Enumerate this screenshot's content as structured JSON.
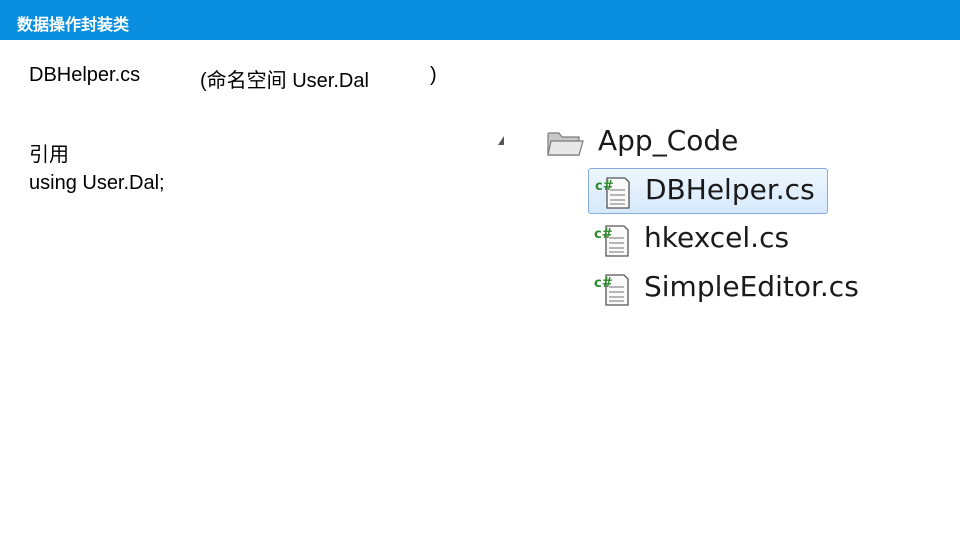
{
  "header": {
    "title": "数据操作封装类"
  },
  "content": {
    "file_name": "DBHelper.cs",
    "namespace_note": "(命名空间 User.Dal",
    "namespace_close": ")",
    "reference_label": "引用",
    "using_statement": "using User.Dal;"
  },
  "tree": {
    "folder": {
      "label": "App_Code",
      "icon": "folder-icon",
      "expanded": true
    },
    "files": [
      {
        "label": "DBHelper.cs",
        "icon": "csharp-file-icon",
        "selected": true
      },
      {
        "label": "hkexcel.cs",
        "icon": "csharp-file-icon",
        "selected": false
      },
      {
        "label": "SimpleEditor.cs",
        "icon": "csharp-file-icon",
        "selected": false
      }
    ]
  },
  "colors": {
    "title_bar": "#0a8fe0",
    "selection_border": "#84acdd",
    "csharp_icon_green": "#2a8a2a"
  }
}
